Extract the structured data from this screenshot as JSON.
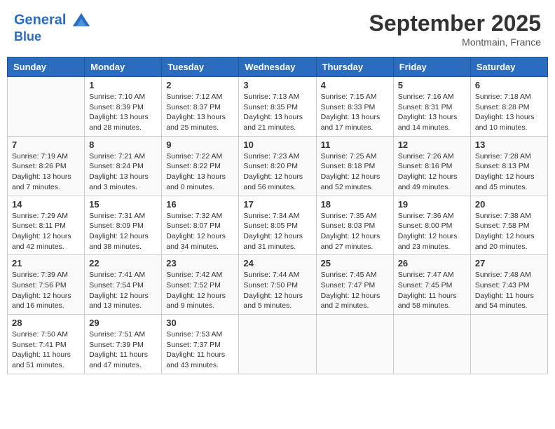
{
  "header": {
    "logo_line1": "General",
    "logo_line2": "Blue",
    "month_year": "September 2025",
    "location": "Montmain, France"
  },
  "weekdays": [
    "Sunday",
    "Monday",
    "Tuesday",
    "Wednesday",
    "Thursday",
    "Friday",
    "Saturday"
  ],
  "weeks": [
    [
      {
        "day": "",
        "sunrise": "",
        "sunset": "",
        "daylight": ""
      },
      {
        "day": "1",
        "sunrise": "Sunrise: 7:10 AM",
        "sunset": "Sunset: 8:39 PM",
        "daylight": "Daylight: 13 hours and 28 minutes."
      },
      {
        "day": "2",
        "sunrise": "Sunrise: 7:12 AM",
        "sunset": "Sunset: 8:37 PM",
        "daylight": "Daylight: 13 hours and 25 minutes."
      },
      {
        "day": "3",
        "sunrise": "Sunrise: 7:13 AM",
        "sunset": "Sunset: 8:35 PM",
        "daylight": "Daylight: 13 hours and 21 minutes."
      },
      {
        "day": "4",
        "sunrise": "Sunrise: 7:15 AM",
        "sunset": "Sunset: 8:33 PM",
        "daylight": "Daylight: 13 hours and 17 minutes."
      },
      {
        "day": "5",
        "sunrise": "Sunrise: 7:16 AM",
        "sunset": "Sunset: 8:31 PM",
        "daylight": "Daylight: 13 hours and 14 minutes."
      },
      {
        "day": "6",
        "sunrise": "Sunrise: 7:18 AM",
        "sunset": "Sunset: 8:28 PM",
        "daylight": "Daylight: 13 hours and 10 minutes."
      }
    ],
    [
      {
        "day": "7",
        "sunrise": "Sunrise: 7:19 AM",
        "sunset": "Sunset: 8:26 PM",
        "daylight": "Daylight: 13 hours and 7 minutes."
      },
      {
        "day": "8",
        "sunrise": "Sunrise: 7:21 AM",
        "sunset": "Sunset: 8:24 PM",
        "daylight": "Daylight: 13 hours and 3 minutes."
      },
      {
        "day": "9",
        "sunrise": "Sunrise: 7:22 AM",
        "sunset": "Sunset: 8:22 PM",
        "daylight": "Daylight: 13 hours and 0 minutes."
      },
      {
        "day": "10",
        "sunrise": "Sunrise: 7:23 AM",
        "sunset": "Sunset: 8:20 PM",
        "daylight": "Daylight: 12 hours and 56 minutes."
      },
      {
        "day": "11",
        "sunrise": "Sunrise: 7:25 AM",
        "sunset": "Sunset: 8:18 PM",
        "daylight": "Daylight: 12 hours and 52 minutes."
      },
      {
        "day": "12",
        "sunrise": "Sunrise: 7:26 AM",
        "sunset": "Sunset: 8:16 PM",
        "daylight": "Daylight: 12 hours and 49 minutes."
      },
      {
        "day": "13",
        "sunrise": "Sunrise: 7:28 AM",
        "sunset": "Sunset: 8:13 PM",
        "daylight": "Daylight: 12 hours and 45 minutes."
      }
    ],
    [
      {
        "day": "14",
        "sunrise": "Sunrise: 7:29 AM",
        "sunset": "Sunset: 8:11 PM",
        "daylight": "Daylight: 12 hours and 42 minutes."
      },
      {
        "day": "15",
        "sunrise": "Sunrise: 7:31 AM",
        "sunset": "Sunset: 8:09 PM",
        "daylight": "Daylight: 12 hours and 38 minutes."
      },
      {
        "day": "16",
        "sunrise": "Sunrise: 7:32 AM",
        "sunset": "Sunset: 8:07 PM",
        "daylight": "Daylight: 12 hours and 34 minutes."
      },
      {
        "day": "17",
        "sunrise": "Sunrise: 7:34 AM",
        "sunset": "Sunset: 8:05 PM",
        "daylight": "Daylight: 12 hours and 31 minutes."
      },
      {
        "day": "18",
        "sunrise": "Sunrise: 7:35 AM",
        "sunset": "Sunset: 8:03 PM",
        "daylight": "Daylight: 12 hours and 27 minutes."
      },
      {
        "day": "19",
        "sunrise": "Sunrise: 7:36 AM",
        "sunset": "Sunset: 8:00 PM",
        "daylight": "Daylight: 12 hours and 23 minutes."
      },
      {
        "day": "20",
        "sunrise": "Sunrise: 7:38 AM",
        "sunset": "Sunset: 7:58 PM",
        "daylight": "Daylight: 12 hours and 20 minutes."
      }
    ],
    [
      {
        "day": "21",
        "sunrise": "Sunrise: 7:39 AM",
        "sunset": "Sunset: 7:56 PM",
        "daylight": "Daylight: 12 hours and 16 minutes."
      },
      {
        "day": "22",
        "sunrise": "Sunrise: 7:41 AM",
        "sunset": "Sunset: 7:54 PM",
        "daylight": "Daylight: 12 hours and 13 minutes."
      },
      {
        "day": "23",
        "sunrise": "Sunrise: 7:42 AM",
        "sunset": "Sunset: 7:52 PM",
        "daylight": "Daylight: 12 hours and 9 minutes."
      },
      {
        "day": "24",
        "sunrise": "Sunrise: 7:44 AM",
        "sunset": "Sunset: 7:50 PM",
        "daylight": "Daylight: 12 hours and 5 minutes."
      },
      {
        "day": "25",
        "sunrise": "Sunrise: 7:45 AM",
        "sunset": "Sunset: 7:47 PM",
        "daylight": "Daylight: 12 hours and 2 minutes."
      },
      {
        "day": "26",
        "sunrise": "Sunrise: 7:47 AM",
        "sunset": "Sunset: 7:45 PM",
        "daylight": "Daylight: 11 hours and 58 minutes."
      },
      {
        "day": "27",
        "sunrise": "Sunrise: 7:48 AM",
        "sunset": "Sunset: 7:43 PM",
        "daylight": "Daylight: 11 hours and 54 minutes."
      }
    ],
    [
      {
        "day": "28",
        "sunrise": "Sunrise: 7:50 AM",
        "sunset": "Sunset: 7:41 PM",
        "daylight": "Daylight: 11 hours and 51 minutes."
      },
      {
        "day": "29",
        "sunrise": "Sunrise: 7:51 AM",
        "sunset": "Sunset: 7:39 PM",
        "daylight": "Daylight: 11 hours and 47 minutes."
      },
      {
        "day": "30",
        "sunrise": "Sunrise: 7:53 AM",
        "sunset": "Sunset: 7:37 PM",
        "daylight": "Daylight: 11 hours and 43 minutes."
      },
      {
        "day": "",
        "sunrise": "",
        "sunset": "",
        "daylight": ""
      },
      {
        "day": "",
        "sunrise": "",
        "sunset": "",
        "daylight": ""
      },
      {
        "day": "",
        "sunrise": "",
        "sunset": "",
        "daylight": ""
      },
      {
        "day": "",
        "sunrise": "",
        "sunset": "",
        "daylight": ""
      }
    ]
  ]
}
